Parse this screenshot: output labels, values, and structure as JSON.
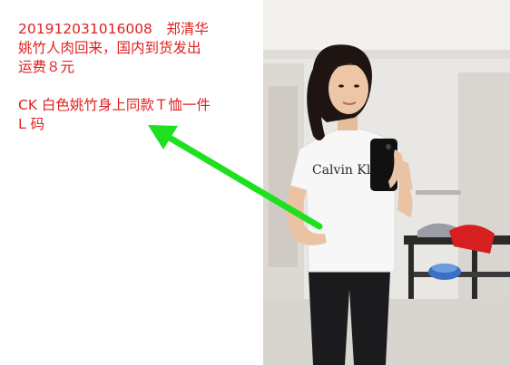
{
  "caption": {
    "line1": "201912031016008　郑清华",
    "line2": "姚竹人肉回来，国内到货发出",
    "line3": "运费８元",
    "line4": "CK 白色姚竹身上同款Ｔ恤一件",
    "line5": "L 码"
  },
  "photo": {
    "shirt_print": "Calvin Klein"
  },
  "colors": {
    "caption_text": "#e0201f",
    "arrow": "#1fe01f"
  }
}
